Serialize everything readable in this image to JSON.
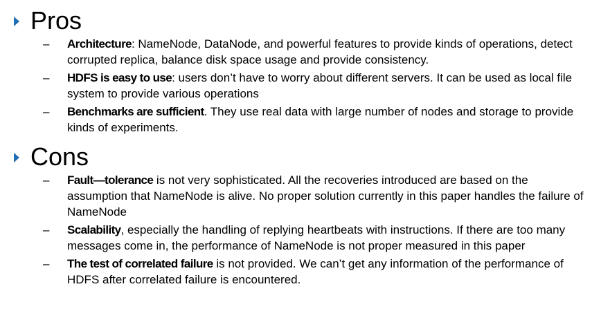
{
  "pros": {
    "title": "Pros",
    "items": [
      {
        "term": "Architecture",
        "text": ": NameNode, DataNode, and powerful features to provide kinds of operations, detect corrupted replica, balance disk space usage and provide consistency."
      },
      {
        "term": "HDFS is easy to use",
        "text": ": users don’t have to worry about different servers. It can be used as local file system to provide various operations"
      },
      {
        "term": "Benchmarks are sufficient",
        "text": ". They use real data with large number of nodes and storage to provide kinds of experiments."
      }
    ]
  },
  "cons": {
    "title": "Cons",
    "items": [
      {
        "term": "Fault—tolerance",
        "text": " is not very sophisticated. All the recoveries introduced are based on the assumption that NameNode is alive. No proper solution currently in this paper handles the failure of NameNode"
      },
      {
        "term": "Scalability",
        "text": ", especially the handling of replying heartbeats with instructions. If there are too many messages come in, the performance of NameNode is not proper measured in this paper"
      },
      {
        "term": "The test of correlated failure",
        "text": " is not provided. We can’t get any information of the performance of HDFS after correlated failure is encountered."
      }
    ]
  },
  "dash_glyph": "–",
  "colors": {
    "bullet_arrow": "#1f6fb2",
    "text": "#000000",
    "background": "#ffffff"
  },
  "icons": {
    "section_bullet": "triangle-right-icon"
  }
}
